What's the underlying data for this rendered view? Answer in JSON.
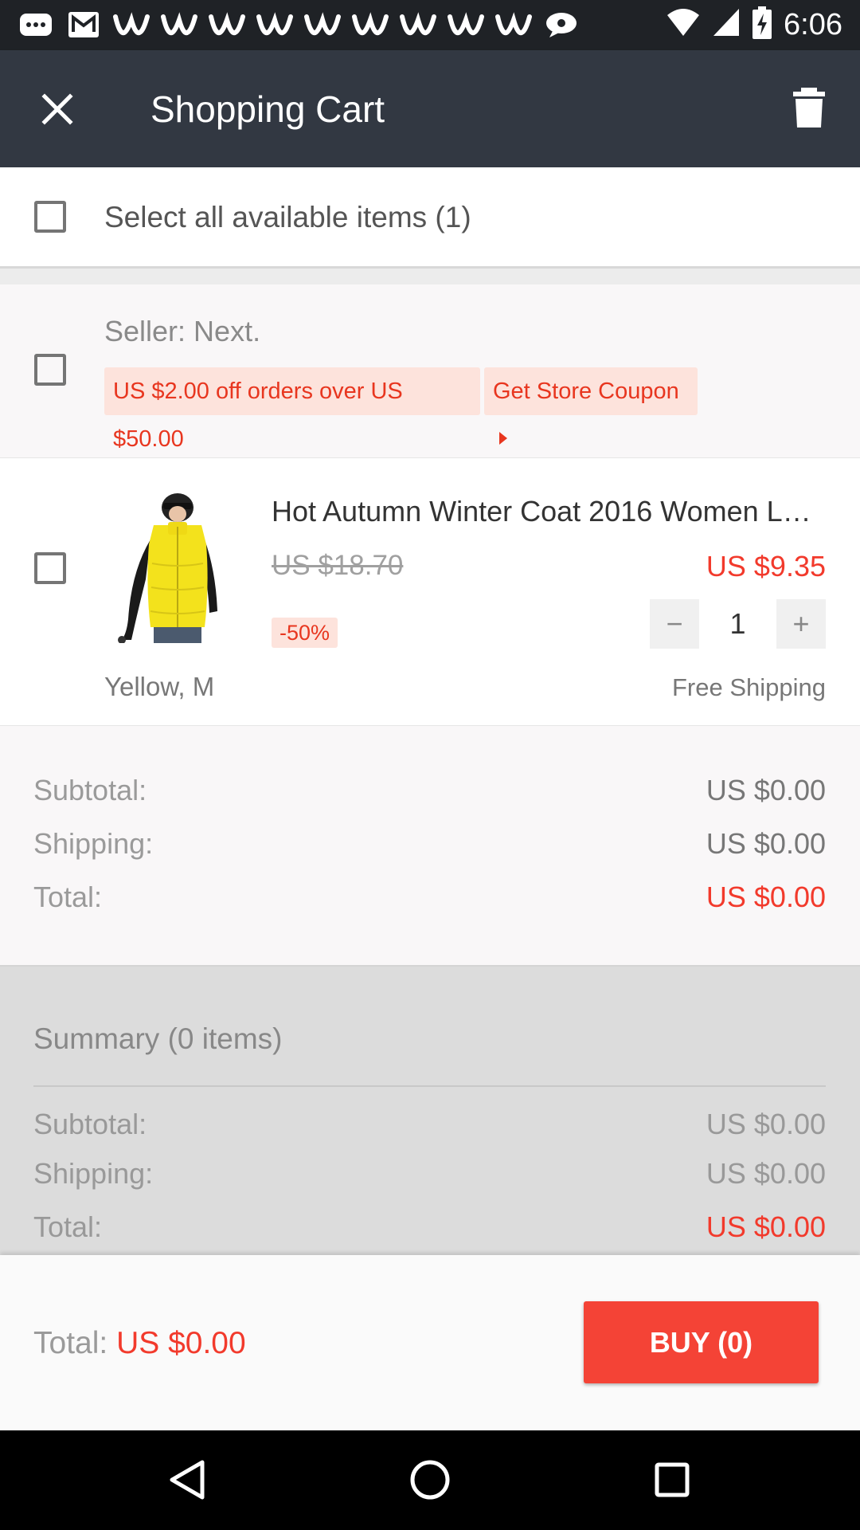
{
  "status_bar": {
    "time": "6:06",
    "icons": [
      "chat-icon",
      "gmail-icon",
      "w-icon",
      "w-icon",
      "w-icon",
      "w-icon",
      "w-icon",
      "w-icon",
      "w-icon",
      "w-icon",
      "w-icon",
      "bubble-icon"
    ]
  },
  "toolbar": {
    "title": "Shopping Cart"
  },
  "select_all": {
    "label": "Select all available items (1)"
  },
  "seller": {
    "label": "Seller:  Next.",
    "coupon_offer": "US $2.00 off orders over US $50.00",
    "coupon_button": "Get Store Coupon"
  },
  "item": {
    "title": "Hot Autumn Winter Coat 2016 Women L…",
    "original_price": "US $18.70",
    "price": "US $9.35",
    "discount": "-50%",
    "quantity": "1",
    "minus": "−",
    "plus": "+",
    "variant": "Yellow, M",
    "shipping": "Free Shipping"
  },
  "order_totals": {
    "subtotal_label": "Subtotal:",
    "subtotal": "US $0.00",
    "shipping_label": "Shipping:",
    "shipping": "US $0.00",
    "total_label": "Total:",
    "total": "US $0.00"
  },
  "summary": {
    "title": "Summary (0 items)",
    "subtotal_label": "Subtotal:",
    "subtotal": "US $0.00",
    "shipping_label": "Shipping:",
    "shipping": "US $0.00",
    "total_label": "Total:",
    "total": "US $0.00"
  },
  "bottom_bar": {
    "total_label": "Total: ",
    "total_value": "US $0.00",
    "buy_label": "BUY (0)"
  },
  "colors": {
    "accent_red": "#f44336",
    "price_red": "#f23a2c",
    "toolbar": "#323842"
  }
}
